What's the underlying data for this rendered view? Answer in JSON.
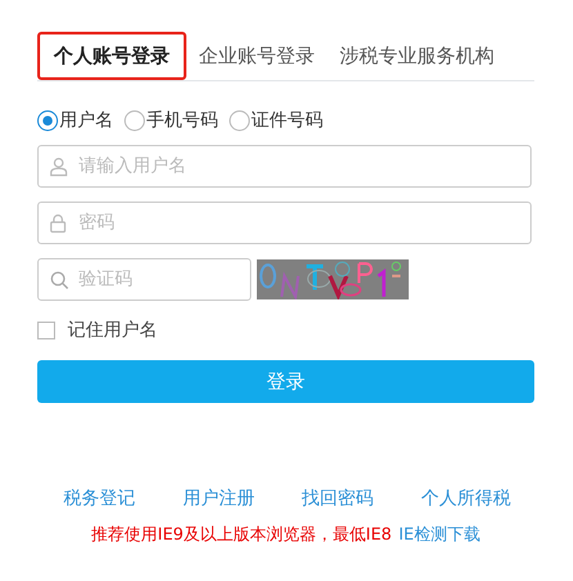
{
  "tabs": [
    {
      "label": "个人账号登录",
      "selected": true
    },
    {
      "label": "企业账号登录",
      "selected": false
    },
    {
      "label": "涉税专业服务机构",
      "selected": false
    }
  ],
  "login_types": [
    {
      "label": "用户名",
      "selected": true
    },
    {
      "label": "手机号码",
      "selected": false
    },
    {
      "label": "证件号码",
      "selected": false
    }
  ],
  "fields": [
    {
      "kind": "user",
      "placeholder": "请输入用户名"
    },
    {
      "kind": "lock",
      "placeholder": "密码"
    }
  ],
  "captcha": {
    "placeholder": "验证码"
  },
  "remember": {
    "label": "记住用户名",
    "checked": false
  },
  "login_button": "登录",
  "links": [
    "税务登记",
    "用户注册",
    "找回密码",
    "个人所得税"
  ],
  "notice": {
    "text": "推荐使用IE9及以上版本浏览器，最低IE8",
    "link": "IE检测下载"
  }
}
